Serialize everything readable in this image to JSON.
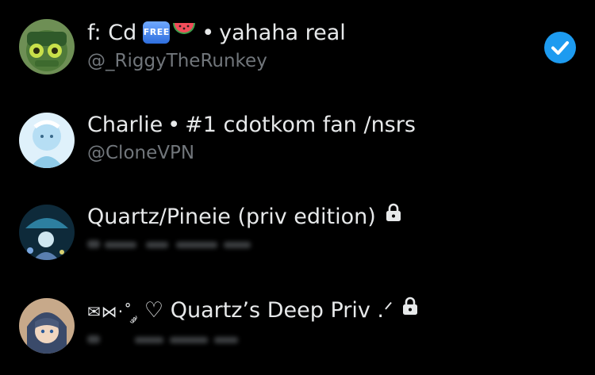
{
  "accounts": [
    {
      "name_prefix": "f: Cd",
      "badge": "FREE",
      "emoji_icon": "watermelon-icon",
      "separator": "•",
      "name_suffix": "yahaha real",
      "handle": "@_RiggyTheRunkey",
      "selected": true
    },
    {
      "name_prefix": "Charlie",
      "separator": "•",
      "name_suffix": "#1 cdotkom fan /nsrs",
      "handle": "@CloneVPN",
      "selected": false
    },
    {
      "name": "Quartz/Pineie (priv edition)",
      "protected": true,
      "handle_obscured": true,
      "selected": false
    },
    {
      "name_deco": "✉⋈·˚ ༘",
      "name": "♡ Quartz’s Deep Priv .ᐟ",
      "protected": true,
      "handle_obscured": true,
      "selected": false
    }
  ],
  "colors": {
    "background": "#000000",
    "name_text": "#e7e9ea",
    "handle_text": "#71767b",
    "accent_check": "#1d9bf0"
  }
}
